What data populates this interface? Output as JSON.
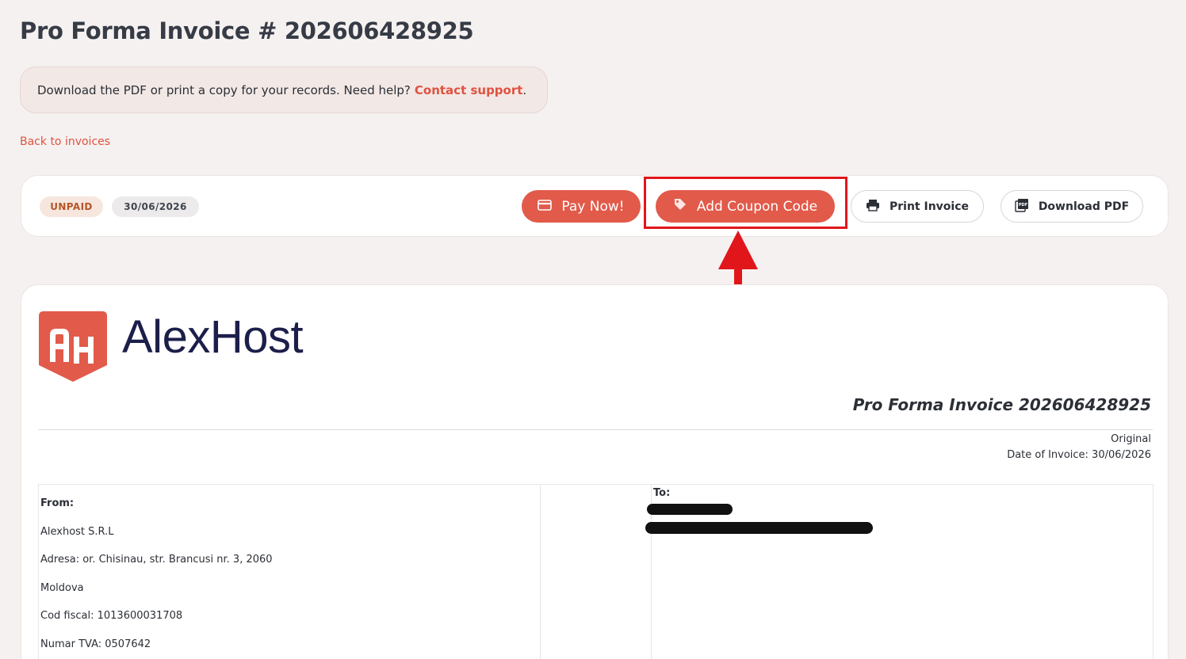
{
  "page": {
    "title": "Pro Forma Invoice # 202606428925"
  },
  "notice": {
    "text": "Download the PDF or print a copy for your records. Need help?",
    "link_label": "Contact support",
    "suffix": "."
  },
  "back_link": "Back to invoices",
  "toolbar": {
    "status_badge": "UNPAID",
    "date_badge": "30/06/2026",
    "pay_label": "Pay Now!",
    "coupon_label": "Add Coupon Code",
    "print_label": "Print Invoice",
    "download_label": "Download PDF"
  },
  "invoice": {
    "logo_text": "AlexHost",
    "title": "Pro Forma Invoice 202606428925",
    "copy_type": "Original",
    "date_line": "Date of Invoice: 30/06/2026",
    "from": {
      "label": "From:",
      "lines": [
        "Alexhost S.R.L",
        "Adresa: or. Chisinau, str. Brancusi nr. 3, 2060",
        "Moldova",
        "Cod fiscal: 1013600031708",
        "Numar TVA: 0507642"
      ]
    },
    "to": {
      "label": "To:"
    }
  },
  "colors": {
    "accent": "#e25a4a",
    "link": "#e05240",
    "highlight": "#e1161b",
    "logo_dark": "#1c1f4a"
  },
  "icons": {
    "pay": "credit-card-icon",
    "coupon": "tag-icon",
    "print": "printer-icon",
    "pdf": "pdf-icon"
  }
}
